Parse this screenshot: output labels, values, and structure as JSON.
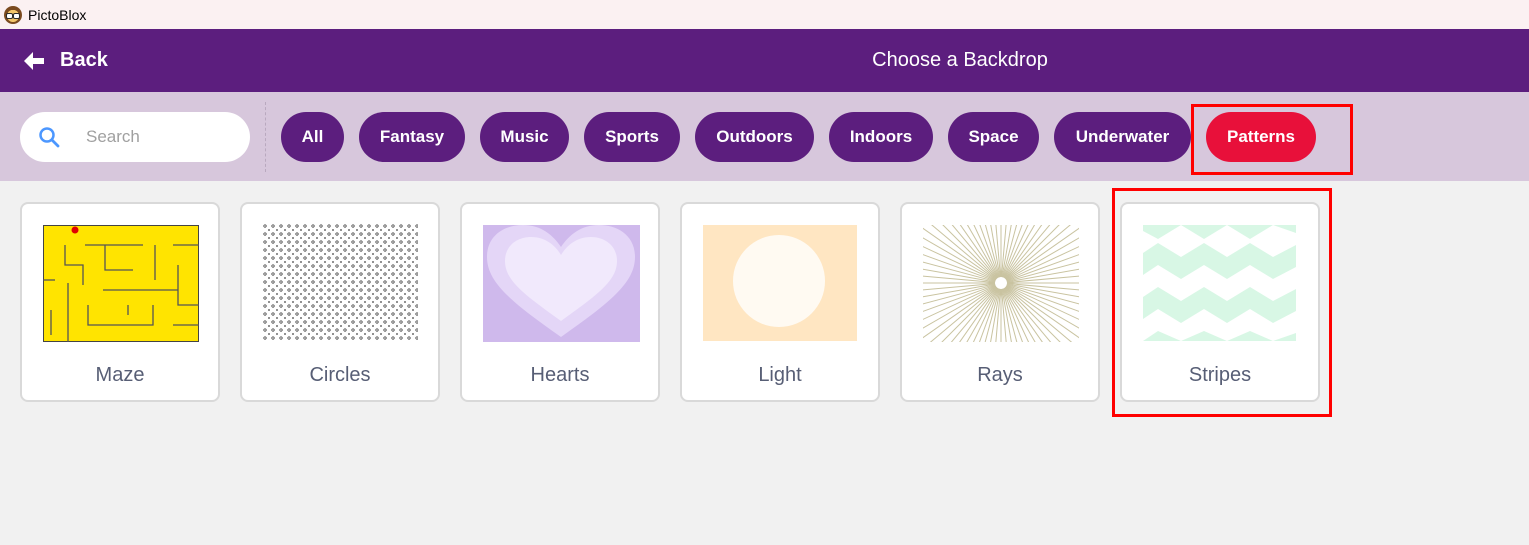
{
  "app": {
    "title": "PictoBlox",
    "icon": "pictoblox-owl-icon"
  },
  "header": {
    "back_label": "Back",
    "title": "Choose a Backdrop",
    "color": "#5c1e7e"
  },
  "search": {
    "placeholder": "Search",
    "value": ""
  },
  "tags": [
    {
      "label": "All",
      "active": false
    },
    {
      "label": "Fantasy",
      "active": false
    },
    {
      "label": "Music",
      "active": false
    },
    {
      "label": "Sports",
      "active": false
    },
    {
      "label": "Outdoors",
      "active": false
    },
    {
      "label": "Indoors",
      "active": false
    },
    {
      "label": "Space",
      "active": false
    },
    {
      "label": "Underwater",
      "active": false
    },
    {
      "label": "Patterns",
      "active": true
    }
  ],
  "backdrops": [
    {
      "name": "Maze"
    },
    {
      "name": "Circles"
    },
    {
      "name": "Hearts"
    },
    {
      "name": "Light"
    },
    {
      "name": "Rays"
    },
    {
      "name": "Stripes"
    }
  ],
  "colors": {
    "accent": "#5c1e7e",
    "active_tag": "#e8103a",
    "filter_bar": "#d7c7dc",
    "highlight": "#ff0000"
  }
}
